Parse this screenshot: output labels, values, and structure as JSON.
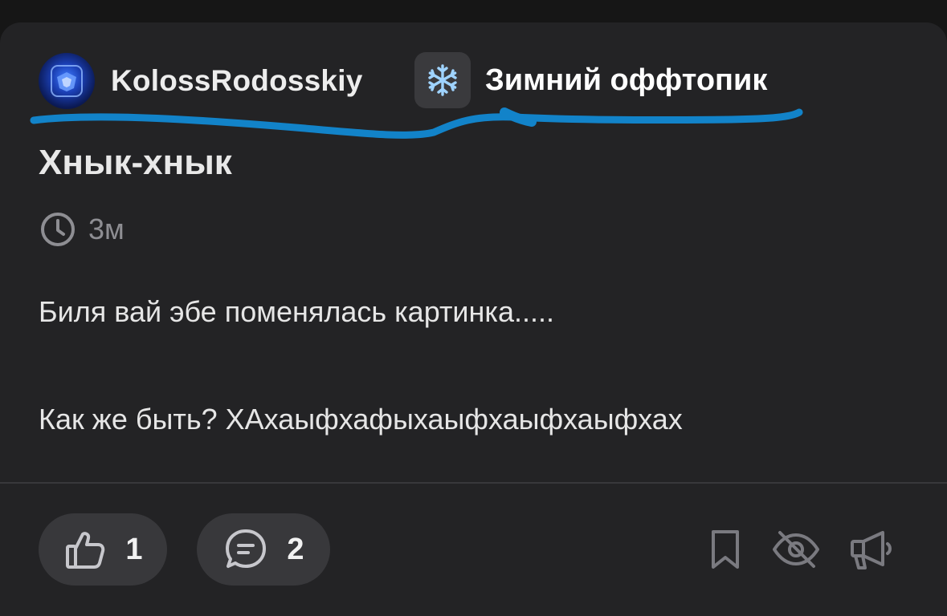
{
  "post": {
    "author": "KolossRodosskiy",
    "community": "Зимний оффтопик",
    "community_icon": "snowflake-icon",
    "title": "Хнык-хнык",
    "time": "3м",
    "body_line1": "Биля вай эбе поменялась картинка.....",
    "body_line2": "Как же быть? ХАхаыфхафыхаыфхаыфхаыфхах"
  },
  "actions": {
    "likes": "1",
    "comments": "2",
    "like_icon": "thumbs-up-icon",
    "comment_icon": "comment-icon",
    "bookmark_icon": "bookmark-icon",
    "hide_icon": "eye-off-icon",
    "report_icon": "megaphone-icon"
  },
  "colors": {
    "background": "#161616",
    "card": "#232325",
    "annotation": "#1283c9",
    "muted": "#8e8e93"
  }
}
